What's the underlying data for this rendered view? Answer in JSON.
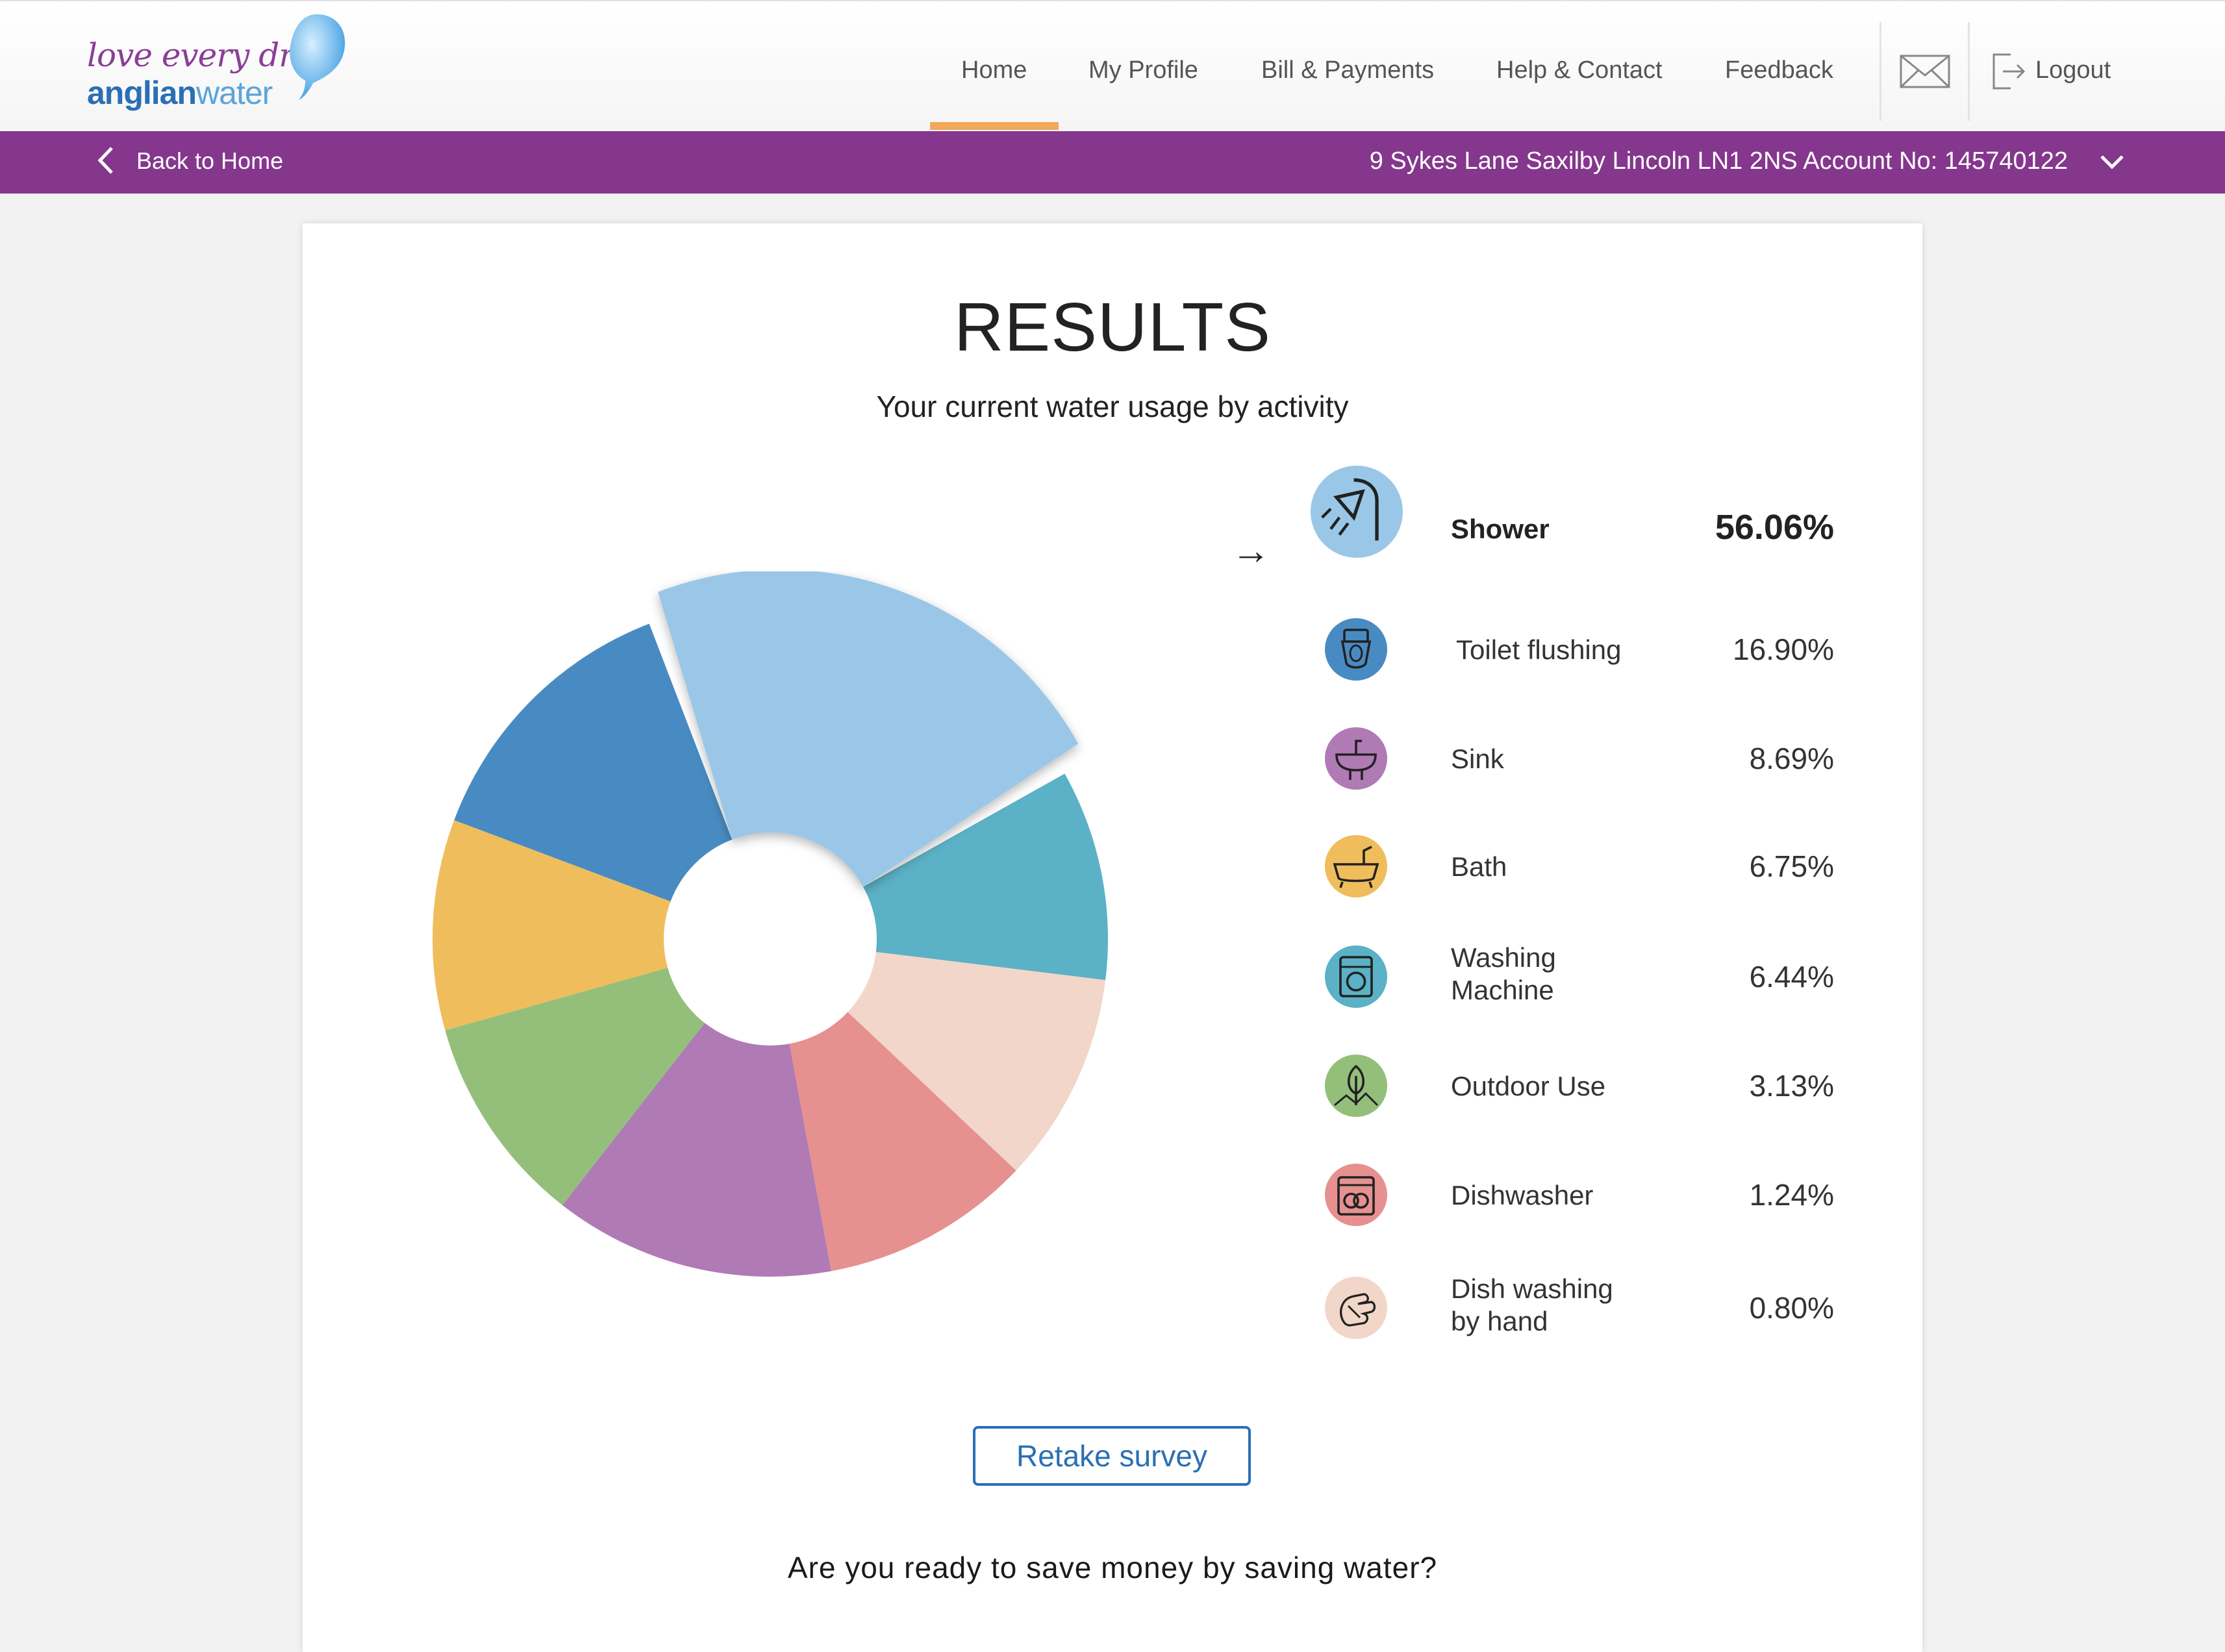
{
  "logo": {
    "line1": "love every drop",
    "line2_bold": "anglian",
    "line2_light": "water"
  },
  "nav": {
    "items": [
      {
        "label": "Home",
        "active": true
      },
      {
        "label": "My Profile"
      },
      {
        "label": "Bill & Payments"
      },
      {
        "label": "Help & Contact"
      },
      {
        "label": "Feedback"
      }
    ],
    "logout_label": "Logout",
    "icons": {
      "messages": "mail-icon",
      "logout": "logout-icon"
    },
    "active_color": "#f3a75a"
  },
  "subbar": {
    "back_label": "Back to Home",
    "address": "9 Sykes Lane Saxilby Lincoln LN1 2NS Account No: 145740122",
    "background": "#84378c"
  },
  "results": {
    "title": "RESULTS",
    "subtitle": "Your current water usage by activity",
    "retake_label": "Retake survey",
    "cta_question": "Are you ready to save money by saving water?"
  },
  "chart_data": {
    "type": "pie",
    "variant": "donut",
    "highlighted": "Shower",
    "slices": [
      {
        "label": "Shower",
        "value": 56.06,
        "display": "56.06%",
        "color": "#9ac7e8",
        "icon": "shower-icon",
        "selected": true
      },
      {
        "label": "Toilet flushing",
        "value": 16.9,
        "display": "16.90%",
        "color": "#488bc3",
        "icon": "toilet-icon"
      },
      {
        "label": "Sink",
        "value": 8.69,
        "display": "8.69%",
        "color": "#b07ab5",
        "icon": "sink-icon"
      },
      {
        "label": "Bath",
        "value": 6.75,
        "display": "6.75%",
        "color": "#efbd5b",
        "icon": "bath-icon"
      },
      {
        "label": "Washing Machine",
        "value": 6.44,
        "display": "6.44%",
        "color": "#5bb1c6",
        "icon": "washing-machine-icon"
      },
      {
        "label": "Outdoor Use",
        "value": 3.13,
        "display": "3.13%",
        "color": "#94bf7a",
        "icon": "outdoor-use-icon"
      },
      {
        "label": "Dishwasher",
        "value": 1.24,
        "display": "1.24%",
        "color": "#e69090",
        "icon": "dishwasher-icon"
      },
      {
        "label": "Dish washing by hand",
        "value": 0.8,
        "display": "0.80%",
        "color": "#f2d6c9",
        "icon": "hand-wash-icon"
      }
    ]
  }
}
